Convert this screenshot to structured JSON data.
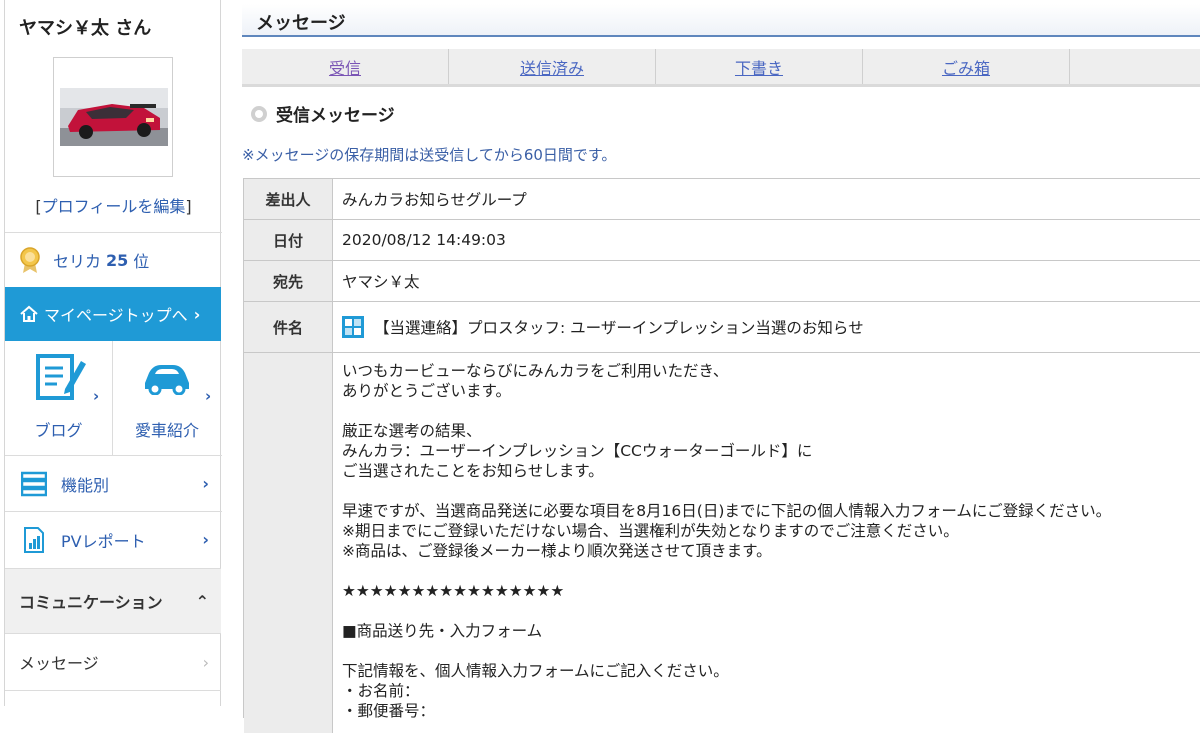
{
  "sidebar": {
    "user_name": "ヤマシ￥太 さん",
    "profile_edit_prefix": "[",
    "profile_edit_link": "プロフィールを編集",
    "profile_edit_suffix": "]",
    "rank_label": "セリカ",
    "rank_value": "25",
    "rank_unit": "位",
    "mypage_button": "マイページトップへ",
    "blog_label": "ブログ",
    "car_label": "愛車紹介",
    "features_label": "機能別",
    "pv_label": "PVレポート",
    "communication_label": "コミュニケーション",
    "message_label": "メッセージ"
  },
  "main": {
    "title": "メッセージ",
    "tabs": [
      "受信",
      "送信済み",
      "下書き",
      "ごみ箱"
    ],
    "section_title": "受信メッセージ",
    "notice": "※メッセージの保存期間は送受信してから60日間です。",
    "fields": {
      "sender_label": "差出人",
      "sender": "みんカラお知らせグループ",
      "date_label": "日付",
      "date": "2020/08/12 14:49:03",
      "to_label": "宛先",
      "to": "ヤマシ￥太",
      "subject_label": "件名",
      "subject": "【当選連絡】プロスタッフ: ユーザーインプレッション当選のお知らせ"
    },
    "body_lines": [
      "いつもカービューならびにみんカラをご利用いただき、",
      "ありがとうございます。",
      "",
      "厳正な選考の結果、",
      "みんカラ：ユーザーインプレッション【CCウォーターゴールド】に",
      "ご当選されたことをお知らせします。",
      "",
      "早速ですが、当選商品発送に必要な項目を8月16日(日)までに下記の個人情報入力フォームにご登録ください。",
      "※期日までにご登録いただけない場合、当選権利が失効となりますのでご注意ください。",
      "※商品は、ご登録後メーカー様より順次発送させて頂きます。",
      "",
      "★★★★★★★★★★★★★★★★",
      "",
      "■商品送り先・入力フォーム",
      "",
      "下記情報を、個人情報入力フォームにご記入ください。",
      "・お名前：",
      "・郵便番号："
    ]
  },
  "colors": {
    "accent_blue": "#1f9ad6",
    "link_blue": "#2e5fb0",
    "header_border": "#5f87bd"
  }
}
